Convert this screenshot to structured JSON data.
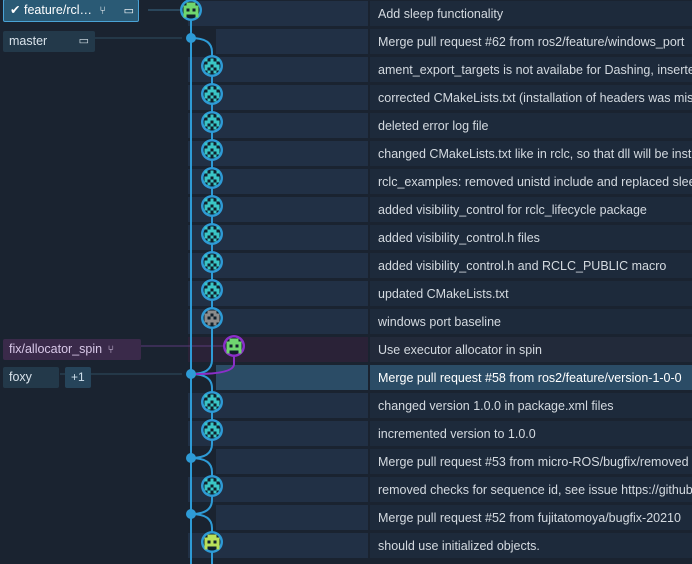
{
  "colors": {
    "branch_main": "#2e9bd6",
    "branch_purple": "#8b2fc9",
    "avatar_green": "#6fd66f",
    "avatar_teal": "#3ac6c6",
    "avatar_gray": "#8c8c8c"
  },
  "refs": {
    "head": {
      "label": "feature/rcl…",
      "check_icon": "check-icon",
      "branch_icon": "branch-icon",
      "laptop_icon": "laptop-icon"
    },
    "master": {
      "label": "master",
      "laptop_icon": "laptop-icon"
    },
    "allocator": {
      "label": "fix/allocator_spin",
      "branch_icon": "branch-icon"
    },
    "foxy": {
      "label": "foxy",
      "more": "+1"
    }
  },
  "commits": [
    {
      "message": "Add sleep functionality",
      "avatar": "green",
      "lane": 0
    },
    {
      "message": "Merge pull request #62 from ros2/feature/windows_port",
      "avatar": "none",
      "lane": 0
    },
    {
      "message": "ament_export_targets is not availabe for Dashing, inserted",
      "avatar": "teal",
      "lane": 1
    },
    {
      "message": "corrected CMakeLists.txt (installation of headers was mis",
      "avatar": "teal",
      "lane": 1
    },
    {
      "message": "deleted error log file",
      "avatar": "teal",
      "lane": 1
    },
    {
      "message": "changed CMakeLists.txt like in rclc, so that dll will be inst",
      "avatar": "teal",
      "lane": 1
    },
    {
      "message": "rclc_examples: removed unistd include and replaced slee",
      "avatar": "teal",
      "lane": 1
    },
    {
      "message": "added visibility_control for rclc_lifecycle package",
      "avatar": "teal",
      "lane": 1
    },
    {
      "message": "added visibility_control.h files",
      "avatar": "teal",
      "lane": 1
    },
    {
      "message": "added visibility_control.h and RCLC_PUBLIC macro",
      "avatar": "teal",
      "lane": 1
    },
    {
      "message": "updated CMakeLists.txt",
      "avatar": "teal",
      "lane": 1
    },
    {
      "message": "windows port baseline",
      "avatar": "gray",
      "lane": 1
    },
    {
      "message": "Use executor allocator in spin",
      "avatar": "green",
      "lane": 2
    },
    {
      "message": "Merge pull request #58 from ros2/feature/version-1-0-0",
      "avatar": "none",
      "lane": 0
    },
    {
      "message": "changed version 1.0.0 in package.xml files",
      "avatar": "teal",
      "lane": 1
    },
    {
      "message": "incremented version to 1.0.0",
      "avatar": "teal",
      "lane": 1
    },
    {
      "message": "Merge pull request #53 from micro-ROS/bugfix/removed",
      "avatar": "none",
      "lane": 0
    },
    {
      "message": "removed checks for sequence id, see issue https://github",
      "avatar": "teal",
      "lane": 1
    },
    {
      "message": "Merge pull request #52 from fujitatomoya/bugfix-20210",
      "avatar": "none",
      "lane": 0
    },
    {
      "message": "should use initialized objects.",
      "avatar": "yellowgreen",
      "lane": 1
    }
  ],
  "selected_row": 13
}
